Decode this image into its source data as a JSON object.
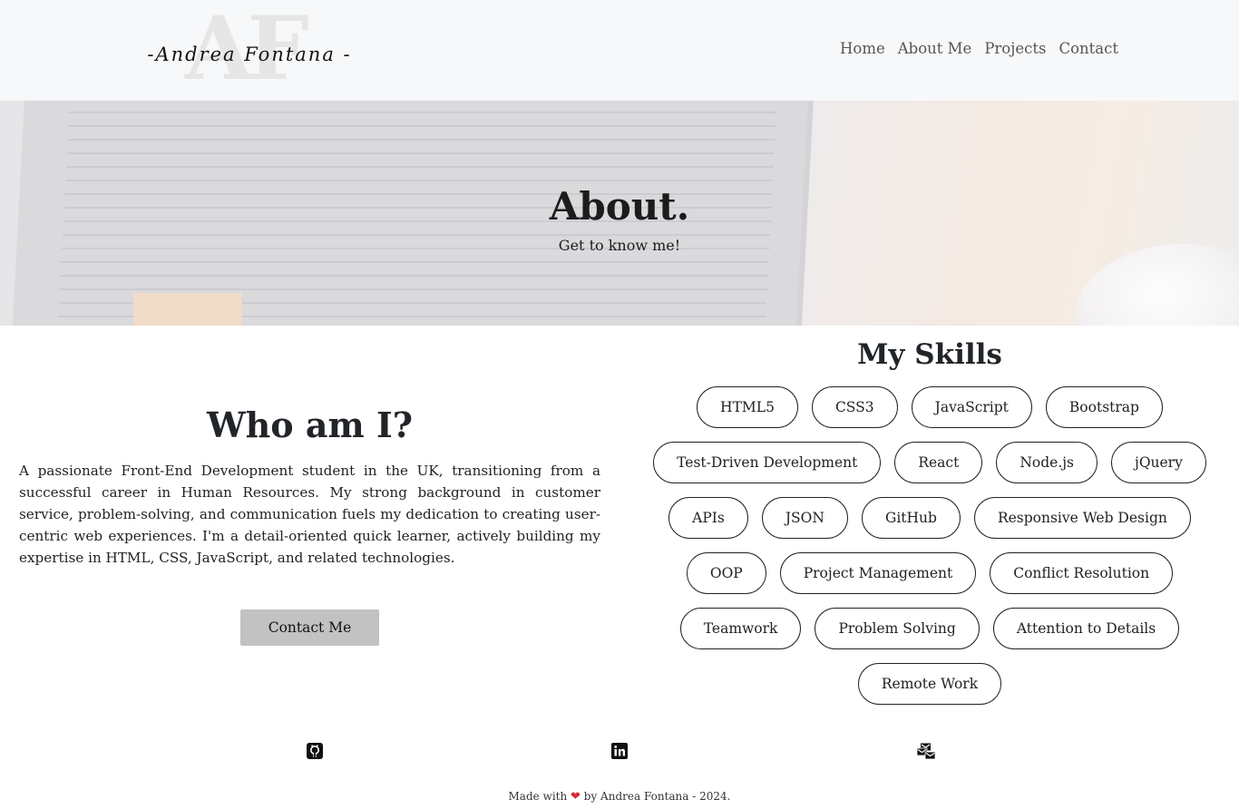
{
  "header": {
    "logo_monogram": "AF",
    "logo_name": "-Andrea Fontana -",
    "nav": [
      "Home",
      "About Me",
      "Projects",
      "Contact"
    ]
  },
  "hero": {
    "title": "About.",
    "subtitle": "Get to know me!"
  },
  "about": {
    "title": "Who am I?",
    "text": "A passionate Front-End Development student in the UK, transitioning from a successful career in Human Resources. My strong background in customer service, problem-solving, and communication fuels my dedication to creating user-centric web experiences. I'm a detail-oriented quick learner, actively building my expertise in HTML, CSS, JavaScript, and related technologies.",
    "button": "Contact Me"
  },
  "skills": {
    "title": "My Skills",
    "rows": [
      [
        "HTML5",
        "CSS3",
        "JavaScript",
        "Bootstrap"
      ],
      [
        "Test-Driven Development",
        "React",
        "Node.js",
        "jQuery"
      ],
      [
        "APIs",
        "JSON",
        "GitHub",
        "Responsive Web Design"
      ],
      [
        "OOP",
        "Project Management",
        "Conflict Resolution"
      ],
      [
        "Teamwork",
        "Problem Solving",
        "Attention to Details"
      ],
      [
        "Remote Work"
      ]
    ]
  },
  "footer": {
    "social_icons": [
      "github-icon",
      "linkedin-icon",
      "mail-icon"
    ],
    "made_with": "Made with",
    "by": "by Andrea Fontana - 2024."
  },
  "colors": {
    "navbar_bg": "#f7f8f9",
    "button_bg": "#c2c2c2",
    "heart": "#d92b3a"
  }
}
